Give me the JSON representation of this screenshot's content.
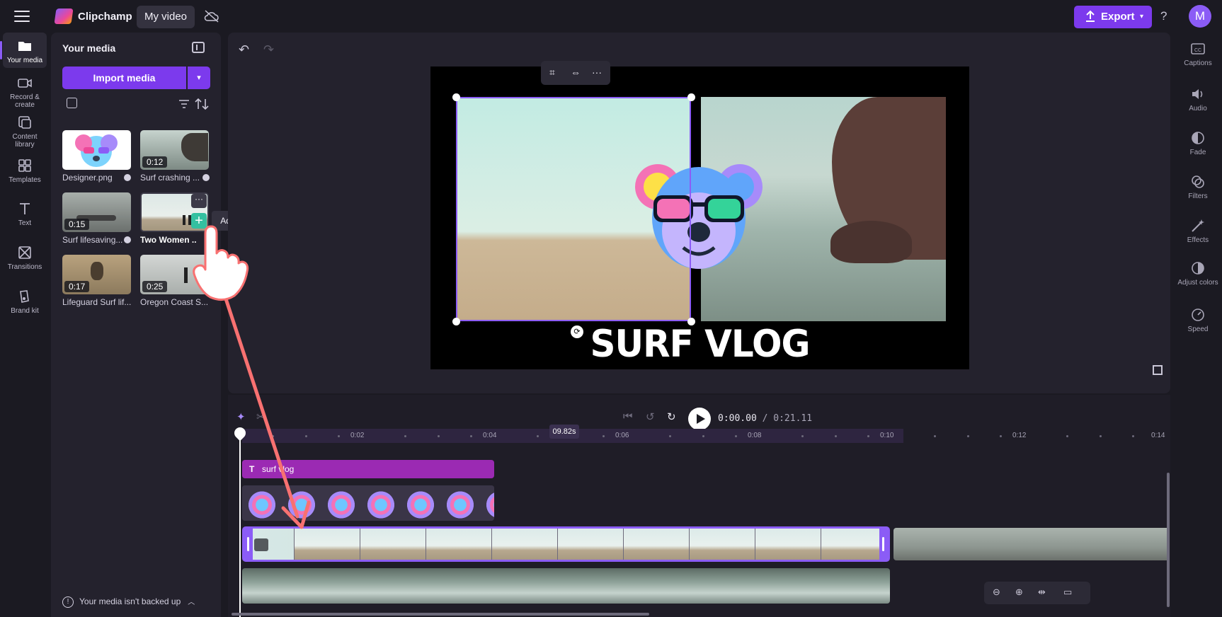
{
  "app": {
    "name": "Clipchamp",
    "project_title": "My video",
    "export_label": "Export",
    "avatar_letter": "M",
    "help_glyph": "?",
    "accent_color": "#7c3aed"
  },
  "left_rail": {
    "items": [
      {
        "label": "Your media",
        "icon": "folder-icon",
        "active": true
      },
      {
        "label": "Record & create",
        "icon": "camera-icon"
      },
      {
        "label": "Content library",
        "icon": "library-icon"
      },
      {
        "label": "Templates",
        "icon": "templates-icon"
      },
      {
        "label": "Text",
        "icon": "text-icon"
      },
      {
        "label": "Transitions",
        "icon": "transitions-icon"
      },
      {
        "label": "Brand kit",
        "icon": "brand-kit-icon"
      }
    ]
  },
  "media_panel": {
    "title": "Your media",
    "import_label": "Import media",
    "items": [
      {
        "name": "Designer.png",
        "duration": "",
        "saved": true
      },
      {
        "name": "Surf crashing ...",
        "duration": "0:12",
        "saved": true
      },
      {
        "name": "Surf lifesaving...",
        "duration": "0:15",
        "saved": true
      },
      {
        "name": "Two Women ...",
        "duration": "",
        "saved": false,
        "hovered": true
      },
      {
        "name": "Lifeguard Surf lif...",
        "duration": "0:17",
        "saved": false
      },
      {
        "name": "Oregon Coast S...",
        "duration": "0:25",
        "saved": false
      }
    ],
    "tooltip": "Add to timeline",
    "backup_notice": "Your media isn't backed up"
  },
  "preview": {
    "title_text": "SURF VLOG",
    "floating_tools": [
      "crop-icon",
      "fit-icon",
      "more-icon"
    ]
  },
  "right_rail": {
    "items": [
      {
        "label": "Captions",
        "icon": "captions-icon"
      },
      {
        "label": "Audio",
        "icon": "audio-icon"
      },
      {
        "label": "Fade",
        "icon": "fade-icon"
      },
      {
        "label": "Filters",
        "icon": "filters-icon"
      },
      {
        "label": "Effects",
        "icon": "effects-icon"
      },
      {
        "label": "Adjust colors",
        "icon": "adjust-colors-icon"
      },
      {
        "label": "Speed",
        "icon": "speed-icon"
      }
    ]
  },
  "timeline": {
    "current_time": "0:00.00",
    "separator": "/",
    "total_time": "0:21.11",
    "hover_time": "09.82s",
    "ticks": [
      "0:02",
      "0:04",
      "0:06",
      "0:08",
      "0:10",
      "0:12",
      "0:14"
    ],
    "text_clip_label": "surf vlog"
  }
}
